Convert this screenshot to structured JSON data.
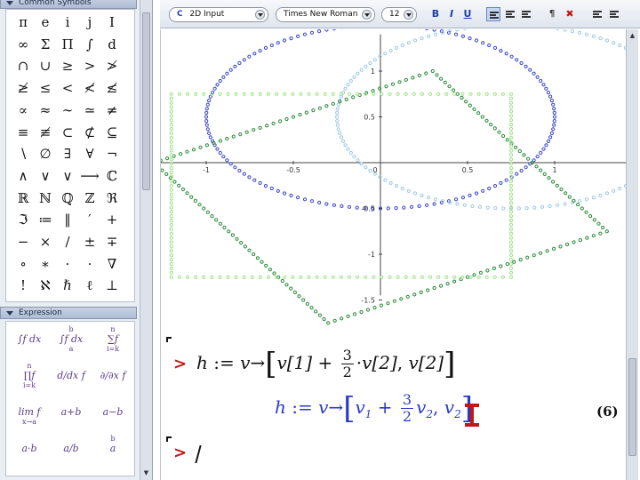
{
  "palettes": {
    "common_symbols": {
      "title": "Common Symbols",
      "symbols": [
        "π",
        "e",
        "i",
        "j",
        "I",
        "∞",
        "Σ",
        "Π",
        "∫",
        "d",
        "∩",
        "∪",
        "≥",
        ">",
        "≯",
        "≱",
        "≤",
        "<",
        "≮",
        "≰",
        "∝",
        "≈",
        "∼",
        "≃",
        "≠",
        "≡",
        "≢",
        "⊂",
        "⊄",
        "⊆",
        "∖",
        "∅",
        "∃",
        "∀",
        "¬",
        "∧",
        "∨",
        "∨",
        "⟶",
        "ℂ",
        "ℝ",
        "ℕ",
        "ℚ",
        "ℤ",
        "ℜ",
        "ℑ",
        "≔",
        "‖",
        "′",
        "+",
        "−",
        "×",
        "/",
        "±",
        "∓",
        "∘",
        "∗",
        "·",
        "·",
        "∇",
        "!",
        "ℵ",
        "ℏ",
        "ℓ",
        "⊥"
      ]
    },
    "expression": {
      "title": "Expression",
      "items": [
        {
          "id": "int-indef",
          "main": "∫f dx",
          "sup": "",
          "sub": ""
        },
        {
          "id": "int-def",
          "main": "∫f dx",
          "sup": "b",
          "sub": "a"
        },
        {
          "id": "sum",
          "main": "∑f",
          "sup": "n",
          "sub": "i=k"
        },
        {
          "id": "prod",
          "main": "∏f",
          "sup": "n",
          "sub": "i=k"
        },
        {
          "id": "deriv",
          "main": "d/dx f",
          "sup": "",
          "sub": ""
        },
        {
          "id": "pderiv",
          "main": "∂/∂x f",
          "sup": "",
          "sub": ""
        },
        {
          "id": "limit",
          "main": "lim f",
          "sup": "",
          "sub": "x→a"
        },
        {
          "id": "plus",
          "main": "a+b",
          "sup": "",
          "sub": ""
        },
        {
          "id": "minus",
          "main": "a−b",
          "sup": "",
          "sub": ""
        },
        {
          "id": "times",
          "main": "a·b",
          "sup": "",
          "sub": ""
        },
        {
          "id": "divide",
          "main": "a/b",
          "sup": "",
          "sub": ""
        },
        {
          "id": "power",
          "main": "a",
          "sup": "b",
          "sub": ""
        }
      ]
    }
  },
  "toolbar": {
    "mode": "2D Input",
    "mode_icon": "C",
    "font": "Times New Roman",
    "size": "12",
    "bold": "B",
    "italic": "I",
    "underline": "U"
  },
  "worksheet": {
    "input": {
      "prompt": ">",
      "lhs": "h",
      "assign": ":=",
      "var": "v",
      "arrow": "→",
      "elem1": "v[1]",
      "plus": "+",
      "frac_num": "3",
      "frac_den": "2",
      "dot": "·",
      "elem2": "v[2]",
      "sep": ",",
      "elem3": "v[2]"
    },
    "output": {
      "lhs": "h",
      "assign": ":=",
      "var": "v",
      "arrow": "→",
      "v": "v",
      "sub1": "1",
      "plus": "+",
      "frac_num": "3",
      "frac_den": "2",
      "sub2": "2",
      "sep": ",",
      "sub3": "2",
      "label": "(6)"
    },
    "next_prompt": ">"
  },
  "chart_data": {
    "type": "scatter",
    "title": "",
    "xlabel": "",
    "ylabel": "",
    "xlim": [
      -1.4,
      1.5
    ],
    "ylim": [
      -1.45,
      1.4
    ],
    "x_ticks": [
      "-1",
      "-0.5",
      "0",
      "0.5",
      "1"
    ],
    "y_ticks": [
      "1",
      "0.5",
      "-0.5",
      "-1",
      "-1.5"
    ],
    "series": [
      {
        "shape": "circle",
        "center": [
          0,
          0.5
        ],
        "radius": 1,
        "color": "#3b46c8"
      },
      {
        "shape": "circle",
        "center": [
          0.75,
          0.5
        ],
        "radius": 1,
        "color": "#9ec8e8"
      },
      {
        "shape": "polygon",
        "vertices": [
          [
            -1.3,
            0
          ],
          [
            0.3,
            1
          ],
          [
            1.3,
            -0.75
          ],
          [
            -0.3,
            -1.75
          ]
        ],
        "color": "#2a8a3a"
      },
      {
        "shape": "polygon",
        "vertices": [
          [
            -1.2,
            0.75
          ],
          [
            0.75,
            0.75
          ],
          [
            0.75,
            -1.25
          ],
          [
            -1.2,
            -1.25
          ]
        ],
        "color": "#9ee08a"
      }
    ]
  }
}
